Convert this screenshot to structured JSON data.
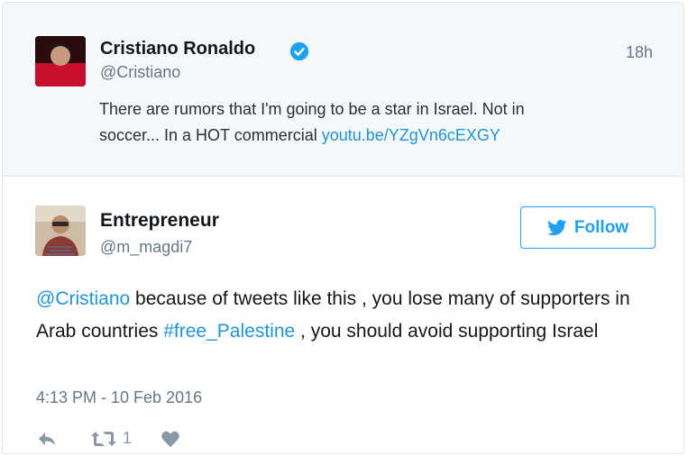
{
  "parent_tweet": {
    "name": "Cristiano Ronaldo",
    "handle": "@Cristiano",
    "time": "18h",
    "text_line1": "There are rumors that I'm going to be a star in Israel. Not in",
    "text_line2_prefix": "soccer... In a HOT commercial ",
    "link": "youtu.be/YZgVn6cEXGY",
    "avatar_icon": "profile-photo",
    "verified_icon": "verified-badge-icon"
  },
  "reply_tweet": {
    "name": "Entrepreneur",
    "handle": "@m_magdi7",
    "follow_label": "Follow",
    "mention": "@Cristiano",
    "text_part1": " because of tweets like this , you lose many of supporters in Arab countries ",
    "hashtag": "#free_Palestine",
    "text_part2": " , you should avoid supporting Israel",
    "timestamp": "4:13 PM - 10 Feb 2016",
    "retweet_count": "1"
  },
  "colors": {
    "accent": "#1da1f2",
    "link": "#1b95e0",
    "muted": "#657786",
    "parent_bg": "#f5f8fa"
  }
}
